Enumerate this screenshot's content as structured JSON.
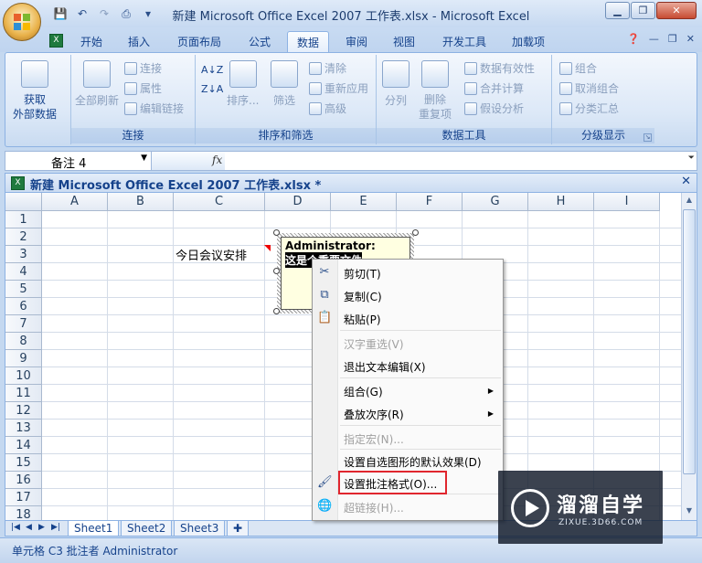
{
  "window": {
    "title": "新建 Microsoft Office Excel 2007 工作表.xlsx - Microsoft Excel"
  },
  "ribbon_tabs": [
    "开始",
    "插入",
    "页面布局",
    "公式",
    "数据",
    "审阅",
    "视图",
    "开发工具",
    "加载项"
  ],
  "active_tab": "数据",
  "groups": {
    "get_external": {
      "label": "获取\n外部数据"
    },
    "connections": {
      "label": "连接",
      "refresh_all": "全部刷新",
      "connections": "连接",
      "properties": "属性",
      "edit_links": "编辑链接"
    },
    "sort_filter": {
      "label": "排序和筛选",
      "sort": "排序...",
      "filter": "筛选",
      "clear": "清除",
      "reapply": "重新应用",
      "advanced": "高级"
    },
    "data_tools": {
      "label": "数据工具",
      "split": "分列",
      "remove_dup": "删除\n重复项",
      "validation": "数据有效性",
      "consolidate": "合并计算",
      "whatif": "假设分析"
    },
    "outline": {
      "label": "分级显示",
      "group": "组合",
      "ungroup": "取消组合",
      "subtotal": "分类汇总"
    }
  },
  "formula_bar": {
    "name_box": "备注 4",
    "fx": "fx"
  },
  "workbook": {
    "title": "新建 Microsoft Office Excel 2007 工作表.xlsx *"
  },
  "columns": [
    "A",
    "B",
    "C",
    "D",
    "E",
    "F",
    "G",
    "H",
    "I"
  ],
  "rows": [
    "1",
    "2",
    "3",
    "4",
    "5",
    "6",
    "7",
    "8",
    "9",
    "10",
    "11",
    "12",
    "13",
    "14",
    "15",
    "16",
    "17",
    "18"
  ],
  "cell_c3": "今日会议安排",
  "comment": {
    "author": "Administrator:",
    "body": "这是个重要文件"
  },
  "context_menu": {
    "cut": "剪切(T)",
    "copy": "复制(C)",
    "paste": "粘贴(P)",
    "reconvert": "汉字重选(V)",
    "exit_edit": "退出文本编辑(X)",
    "group": "组合(G)",
    "order": "叠放次序(R)",
    "assign_macro": "指定宏(N)...",
    "set_default": "设置自选图形的默认效果(D)",
    "format_comment": "设置批注格式(O)...",
    "hyperlink": "超链接(H)..."
  },
  "sheet_tabs": [
    "Sheet1",
    "Sheet2",
    "Sheet3"
  ],
  "status": {
    "text": "单元格 C3 批注者 Administrator"
  },
  "watermark": {
    "cn": "溜溜自学",
    "url": "ZIXUE.3D66.COM"
  }
}
